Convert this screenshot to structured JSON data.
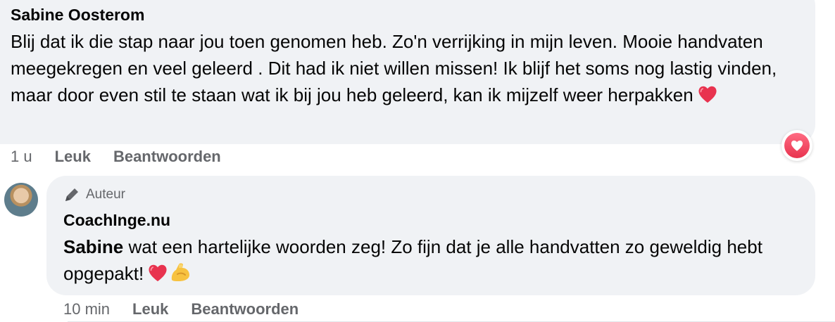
{
  "comments": [
    {
      "author": "Sabine Oosterom",
      "text": "Blij dat ik die stap naar jou toen genomen heb. Zo'n verrijking in mijn leven. Mooie handvaten meegekregen en veel geleerd . Dit had ik niet willen missen! Ik blijf het soms nog lastig vinden, maar door even stil te staan wat ik bij jou heb geleerd, kan ik mijzelf weer herpakken",
      "emoji": [
        "red-heart"
      ],
      "time": "1 u",
      "like_label": "Leuk",
      "reply_label": "Beantwoorden",
      "reaction": "love"
    },
    {
      "badge": "Auteur",
      "author": "CoachInge.nu",
      "mention": "Sabine",
      "text": " wat een hartelijke woorden zeg! Zo fijn dat je alle handvatten zo geweldig hebt opgepakt!",
      "emoji": [
        "red-heart",
        "flexed-biceps"
      ],
      "time": "10 min",
      "like_label": "Leuk",
      "reply_label": "Beantwoorden"
    }
  ],
  "colors": {
    "bubble": "#f0f2f5",
    "secondary_text": "#65676b",
    "heart": "#e8334f"
  }
}
